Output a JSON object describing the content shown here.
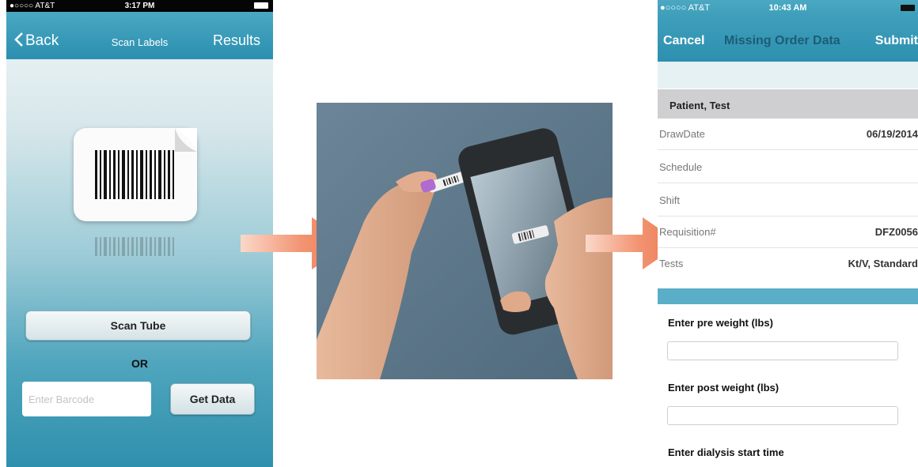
{
  "left_screen": {
    "status_bar": {
      "carrier": "●○○○○ AT&T",
      "time": "3:17 PM"
    },
    "nav": {
      "back_label": "Back",
      "title": "Scan Labels",
      "right_label": "Results"
    },
    "scan_button": "Scan Tube",
    "or_text": "OR",
    "barcode_input": {
      "placeholder": "Enter Barcode",
      "value": ""
    },
    "get_data_button": "Get Data"
  },
  "right_screen": {
    "status_bar": {
      "carrier": "●○○○○ AT&T",
      "time": "10:43 AM"
    },
    "nav": {
      "cancel_label": "Cancel",
      "title": "Missing Order Data",
      "submit_label": "Submit"
    },
    "section_header": "Patient, Test",
    "rows": [
      {
        "key": "DrawDate",
        "value": "06/19/2014"
      },
      {
        "key": "Schedule",
        "value": ""
      },
      {
        "key": "Shift",
        "value": ""
      },
      {
        "key": "Requisition#",
        "value": "DFZ0056"
      },
      {
        "key": "Tests",
        "value": "Kt/V, Standard"
      }
    ],
    "fields": [
      {
        "label": "Enter pre weight (lbs)",
        "value": ""
      },
      {
        "label": "Enter post weight (lbs)",
        "value": ""
      },
      {
        "label": "Enter dialysis start time"
      }
    ]
  },
  "colors": {
    "nav_teal": "#3f9fbb",
    "nav_title_dark": "#1d5c74",
    "arrow": "#ee7a52"
  }
}
